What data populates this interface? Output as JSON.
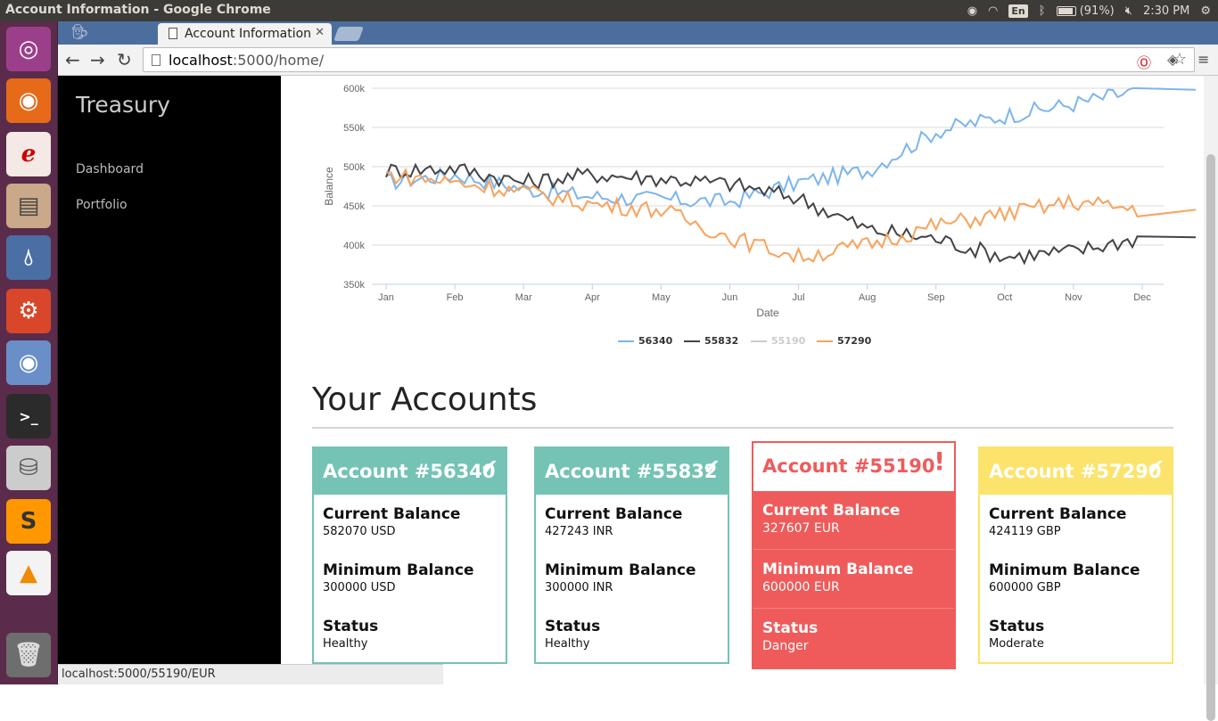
{
  "window": {
    "title": "Account Information - Google Chrome"
  },
  "tray": {
    "lang": "En",
    "battery": "(91%)",
    "time": "2:30 PM"
  },
  "browser": {
    "tab_title": "Account Information",
    "url_host": "localhost",
    "url_rest": ":5000/home/",
    "status_url": "localhost:5000/55190/EUR"
  },
  "sidebar": {
    "brand": "Treasury",
    "items": [
      {
        "label": "Dashboard"
      },
      {
        "label": "Portfolio"
      }
    ]
  },
  "accounts_title": "Your Accounts",
  "colors": {
    "teal": "#74c3b5",
    "danger": "#ef5b5b",
    "yellow": "#fce36b",
    "series_blue": "#7cb5ec",
    "series_dark": "#434348",
    "series_grey": "#cccccc",
    "series_orange": "#f7a35c"
  },
  "accounts": [
    {
      "title": "Account #56340",
      "mark": "✔",
      "status_kind": "healthy",
      "current_label": "Current Balance",
      "current": "582070 USD",
      "min_label": "Minimum Balance",
      "minimum": "300000 USD",
      "status_label": "Status",
      "status": "Healthy"
    },
    {
      "title": "Account #55832",
      "mark": "✔",
      "status_kind": "healthy",
      "current_label": "Current Balance",
      "current": "427243 INR",
      "min_label": "Minimum Balance",
      "minimum": "300000 INR",
      "status_label": "Status",
      "status": "Healthy"
    },
    {
      "title": "Account #55190",
      "mark": "!",
      "status_kind": "danger",
      "current_label": "Current Balance",
      "current": "327607 EUR",
      "min_label": "Minimum Balance",
      "minimum": "600000 EUR",
      "status_label": "Status",
      "status": "Danger"
    },
    {
      "title": "Account #57290",
      "mark": "✔",
      "status_kind": "moderate",
      "current_label": "Current Balance",
      "current": "424119 GBP",
      "min_label": "Minimum Balance",
      "minimum": "600000 GBP",
      "status_label": "Status",
      "status": "Moderate"
    }
  ],
  "chart_data": {
    "type": "line",
    "xlabel": "Date",
    "ylabel": "Balance",
    "ylim": [
      350000,
      600000
    ],
    "yticks": [
      "350k",
      "400k",
      "450k",
      "500k",
      "550k",
      "600k"
    ],
    "x": [
      "Jan",
      "Feb",
      "Mar",
      "Apr",
      "May",
      "Jun",
      "Jul",
      "Aug",
      "Sep",
      "Oct",
      "Nov",
      "Dec"
    ],
    "legend_position": "bottom",
    "series": [
      {
        "name": "56340",
        "color": "#7cb5ec",
        "values": [
          480000,
          490000,
          472000,
          462000,
          458000,
          455000,
          480000,
          495000,
          545000,
          565000,
          580000,
          598000
        ]
      },
      {
        "name": "55832",
        "color": "#434348",
        "values": [
          495000,
          498000,
          480000,
          490000,
          485000,
          478000,
          460000,
          420000,
          408000,
          385000,
          392000,
          410000
        ]
      },
      {
        "name": "55190",
        "color": "#cccccc",
        "visible": false,
        "values": []
      },
      {
        "name": "57290",
        "color": "#f7a35c",
        "values": [
          490000,
          480000,
          468000,
          452000,
          445000,
          410000,
          385000,
          400000,
          425000,
          440000,
          455000,
          445000
        ]
      }
    ]
  }
}
